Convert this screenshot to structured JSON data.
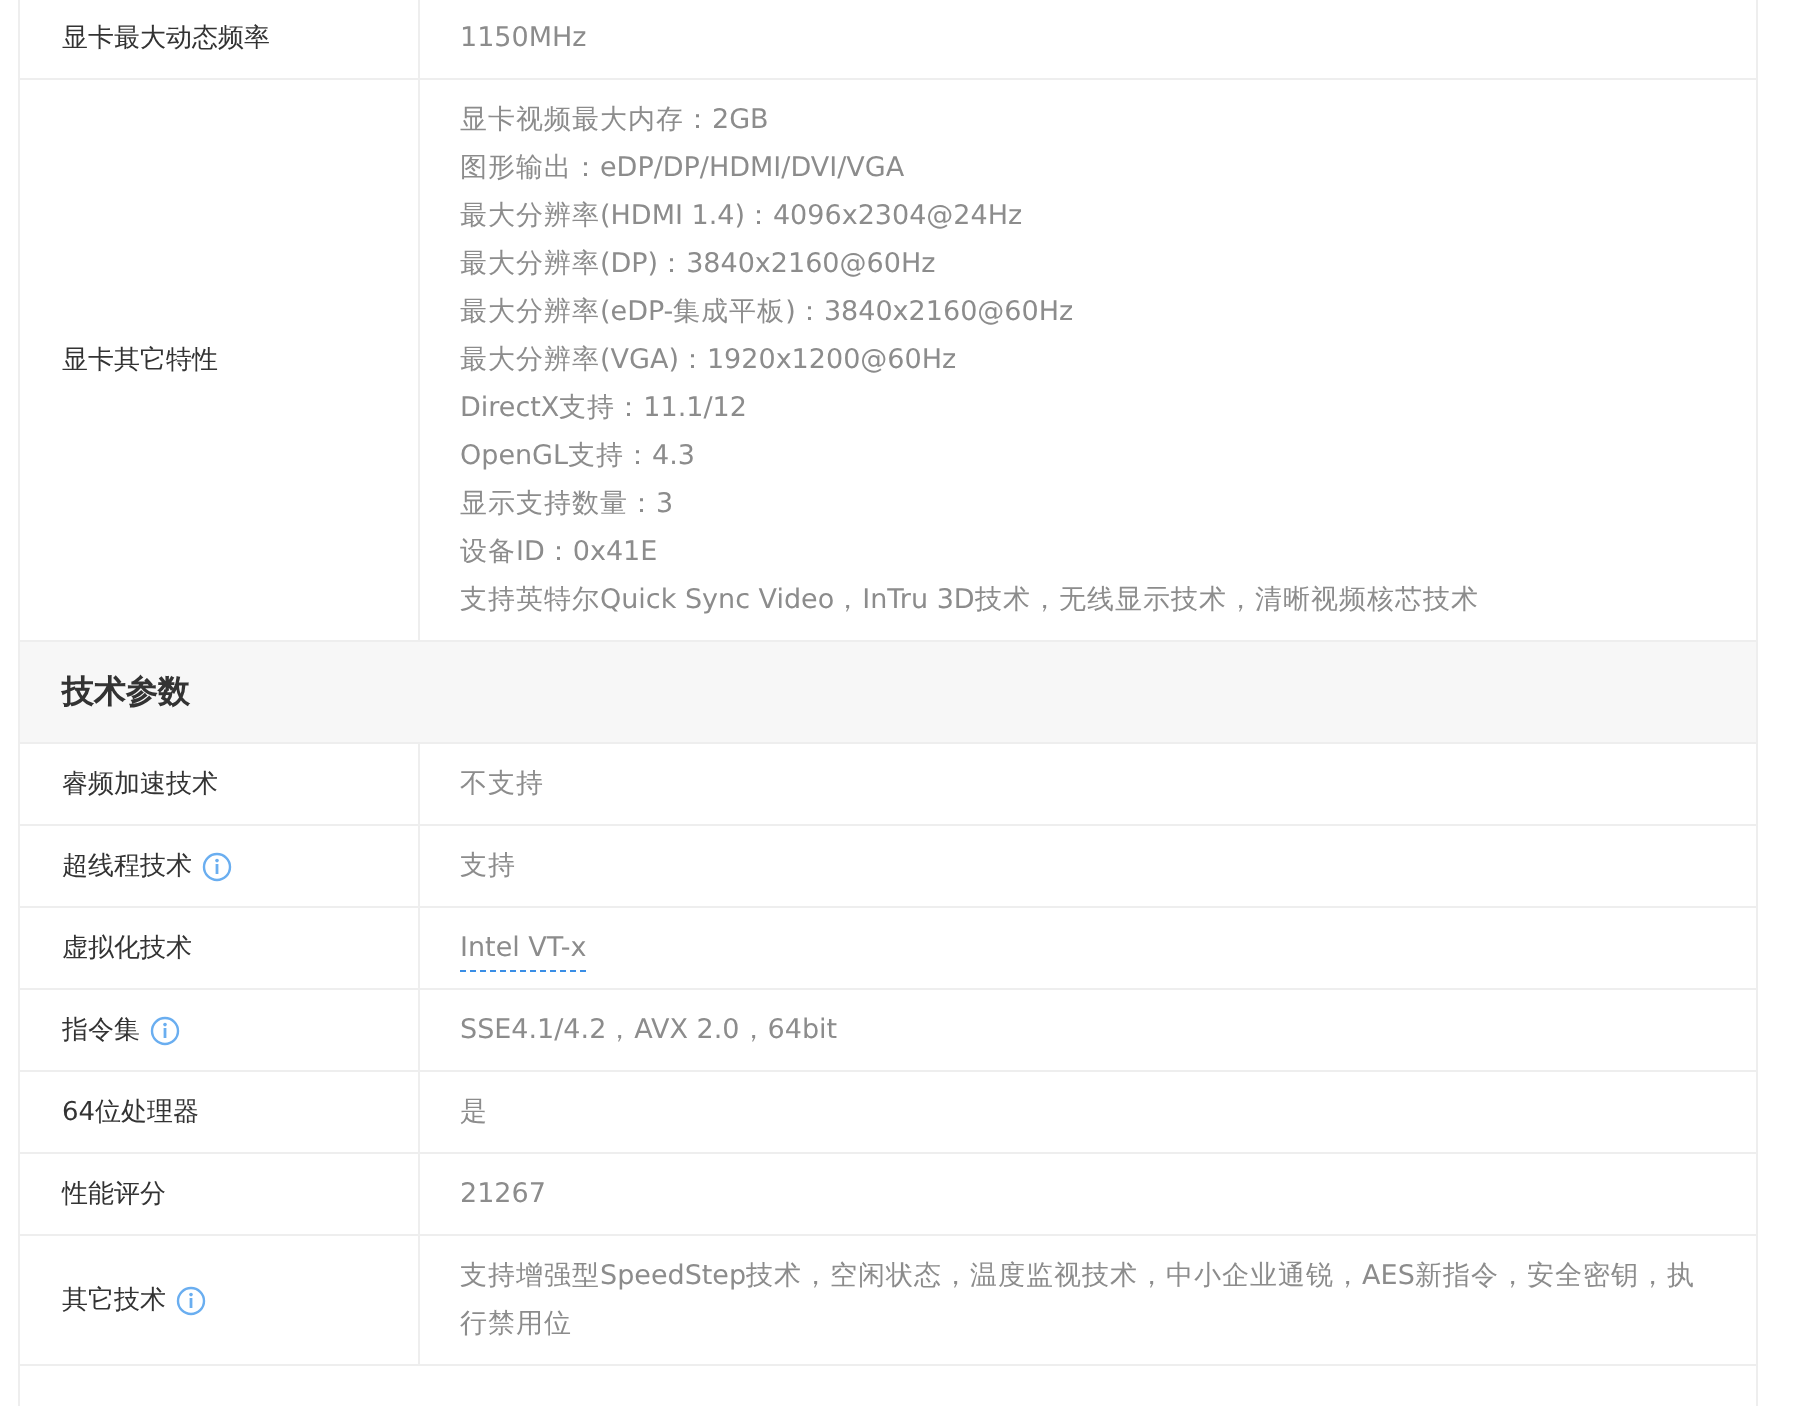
{
  "sections": [
    {
      "rows": [
        {
          "label": "显卡最大动态频率",
          "info": false,
          "value": [
            "1150MHz"
          ],
          "link": false
        },
        {
          "label": "显卡其它特性",
          "info": false,
          "link": false,
          "value": [
            "显卡视频最大内存：2GB",
            "图形输出：eDP/DP/HDMI/DVI/VGA",
            "最大分辨率(HDMI 1.4)：4096x2304@24Hz",
            "最大分辨率(DP)：3840x2160@60Hz",
            "最大分辨率(eDP-集成平板)：3840x2160@60Hz",
            "最大分辨率(VGA)：1920x1200@60Hz",
            "DirectX支持：11.1/12",
            "OpenGL支持：4.3",
            "显示支持数量：3",
            "设备ID：0x41E",
            "支持英特尔Quick Sync Video，InTru 3D技术，无线显示技术，清晰视频核芯技术"
          ]
        }
      ]
    },
    {
      "title": "技术参数",
      "rows": [
        {
          "label": "睿频加速技术",
          "info": false,
          "link": false,
          "value": [
            "不支持"
          ]
        },
        {
          "label": "超线程技术",
          "info": true,
          "link": false,
          "value": [
            "支持"
          ]
        },
        {
          "label": "虚拟化技术",
          "info": false,
          "link": true,
          "value": [
            "Intel VT-x"
          ]
        },
        {
          "label": "指令集",
          "info": true,
          "link": false,
          "value": [
            "SSE4.1/4.2，AVX 2.0，64bit"
          ]
        },
        {
          "label": "64位处理器",
          "info": false,
          "link": false,
          "value": [
            "是"
          ]
        },
        {
          "label": "性能评分",
          "info": false,
          "link": false,
          "value": [
            "21267"
          ]
        },
        {
          "label": "其它技术",
          "info": true,
          "link": false,
          "value": [
            "支持增强型SpeedStep技术，空闲状态，温度监视技术，中小企业通锐，AES新指令，安全密钥，执行禁用位"
          ]
        }
      ]
    }
  ]
}
